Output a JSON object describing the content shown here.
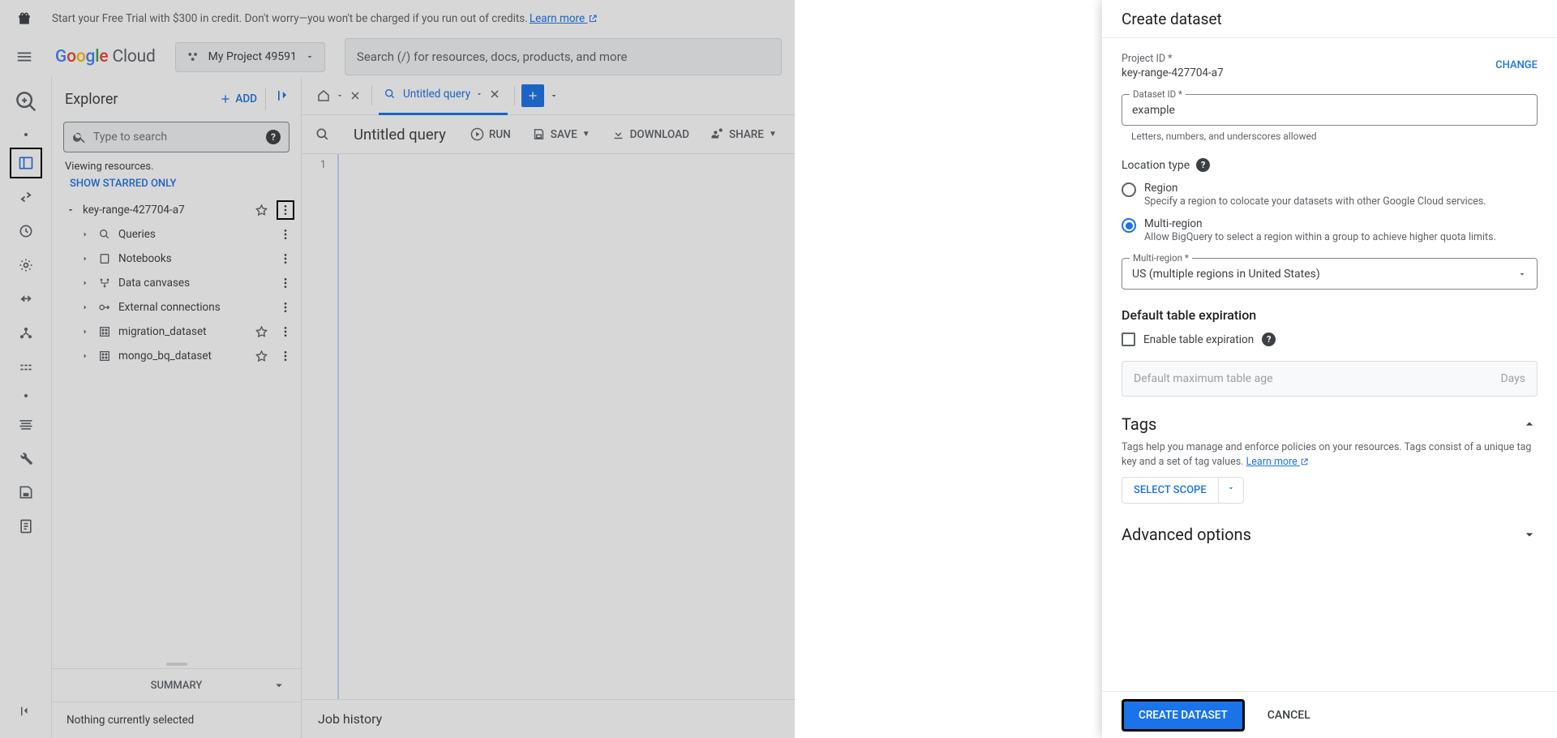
{
  "promo": {
    "text": "Start your Free Trial with $300 in credit. Don't worry—you won't be charged if you run out of credits. ",
    "link": "Learn more"
  },
  "header": {
    "project": "My Project 49591",
    "search_placeholder": "Search (/) for resources, docs, products, and more"
  },
  "explorer": {
    "title": "Explorer",
    "add": "ADD",
    "search_placeholder": "Type to search",
    "viewing": "Viewing resources.",
    "starred": "SHOW STARRED ONLY",
    "project": "key-range-427704-a7",
    "nodes": [
      {
        "label": "Queries"
      },
      {
        "label": "Notebooks"
      },
      {
        "label": "Data canvases"
      },
      {
        "label": "External connections"
      },
      {
        "label": "migration_dataset"
      },
      {
        "label": "mongo_bq_dataset"
      }
    ],
    "summary": "SUMMARY",
    "summary_body": "Nothing currently selected"
  },
  "editor": {
    "tab_untitled": "Untitled query",
    "title": "Untitled query",
    "run": "RUN",
    "save": "SAVE",
    "download": "DOWNLOAD",
    "share": "SHARE",
    "line_no": "1",
    "job_history": "Job history"
  },
  "panel": {
    "title": "Create dataset",
    "project_id_label": "Project ID *",
    "project_id_value": "key-range-427704-a7",
    "change": "CHANGE",
    "dataset_id_label": "Dataset ID *",
    "dataset_id_value": "example",
    "dataset_id_hint": "Letters, numbers, and underscores allowed",
    "location_type": "Location type",
    "region_label": "Region",
    "region_desc": "Specify a region to colocate your datasets with other Google Cloud services.",
    "multiregion_label": "Multi-region",
    "multiregion_desc": "Allow BigQuery to select a region within a group to achieve higher quota limits.",
    "multiregion_select_label": "Multi-region *",
    "multiregion_select_value": "US (multiple regions in United States)",
    "expiration_head": "Default table expiration",
    "enable_expiration": "Enable table expiration",
    "max_age_placeholder": "Default maximum table age",
    "days": "Days",
    "tags_head": "Tags",
    "tags_desc": "Tags help you manage and enforce policies on your resources. Tags consist of a unique tag key and a set of tag values. ",
    "tags_link": "Learn more",
    "select_scope": "SELECT SCOPE",
    "advanced": "Advanced options",
    "create": "CREATE DATASET",
    "cancel": "CANCEL"
  }
}
